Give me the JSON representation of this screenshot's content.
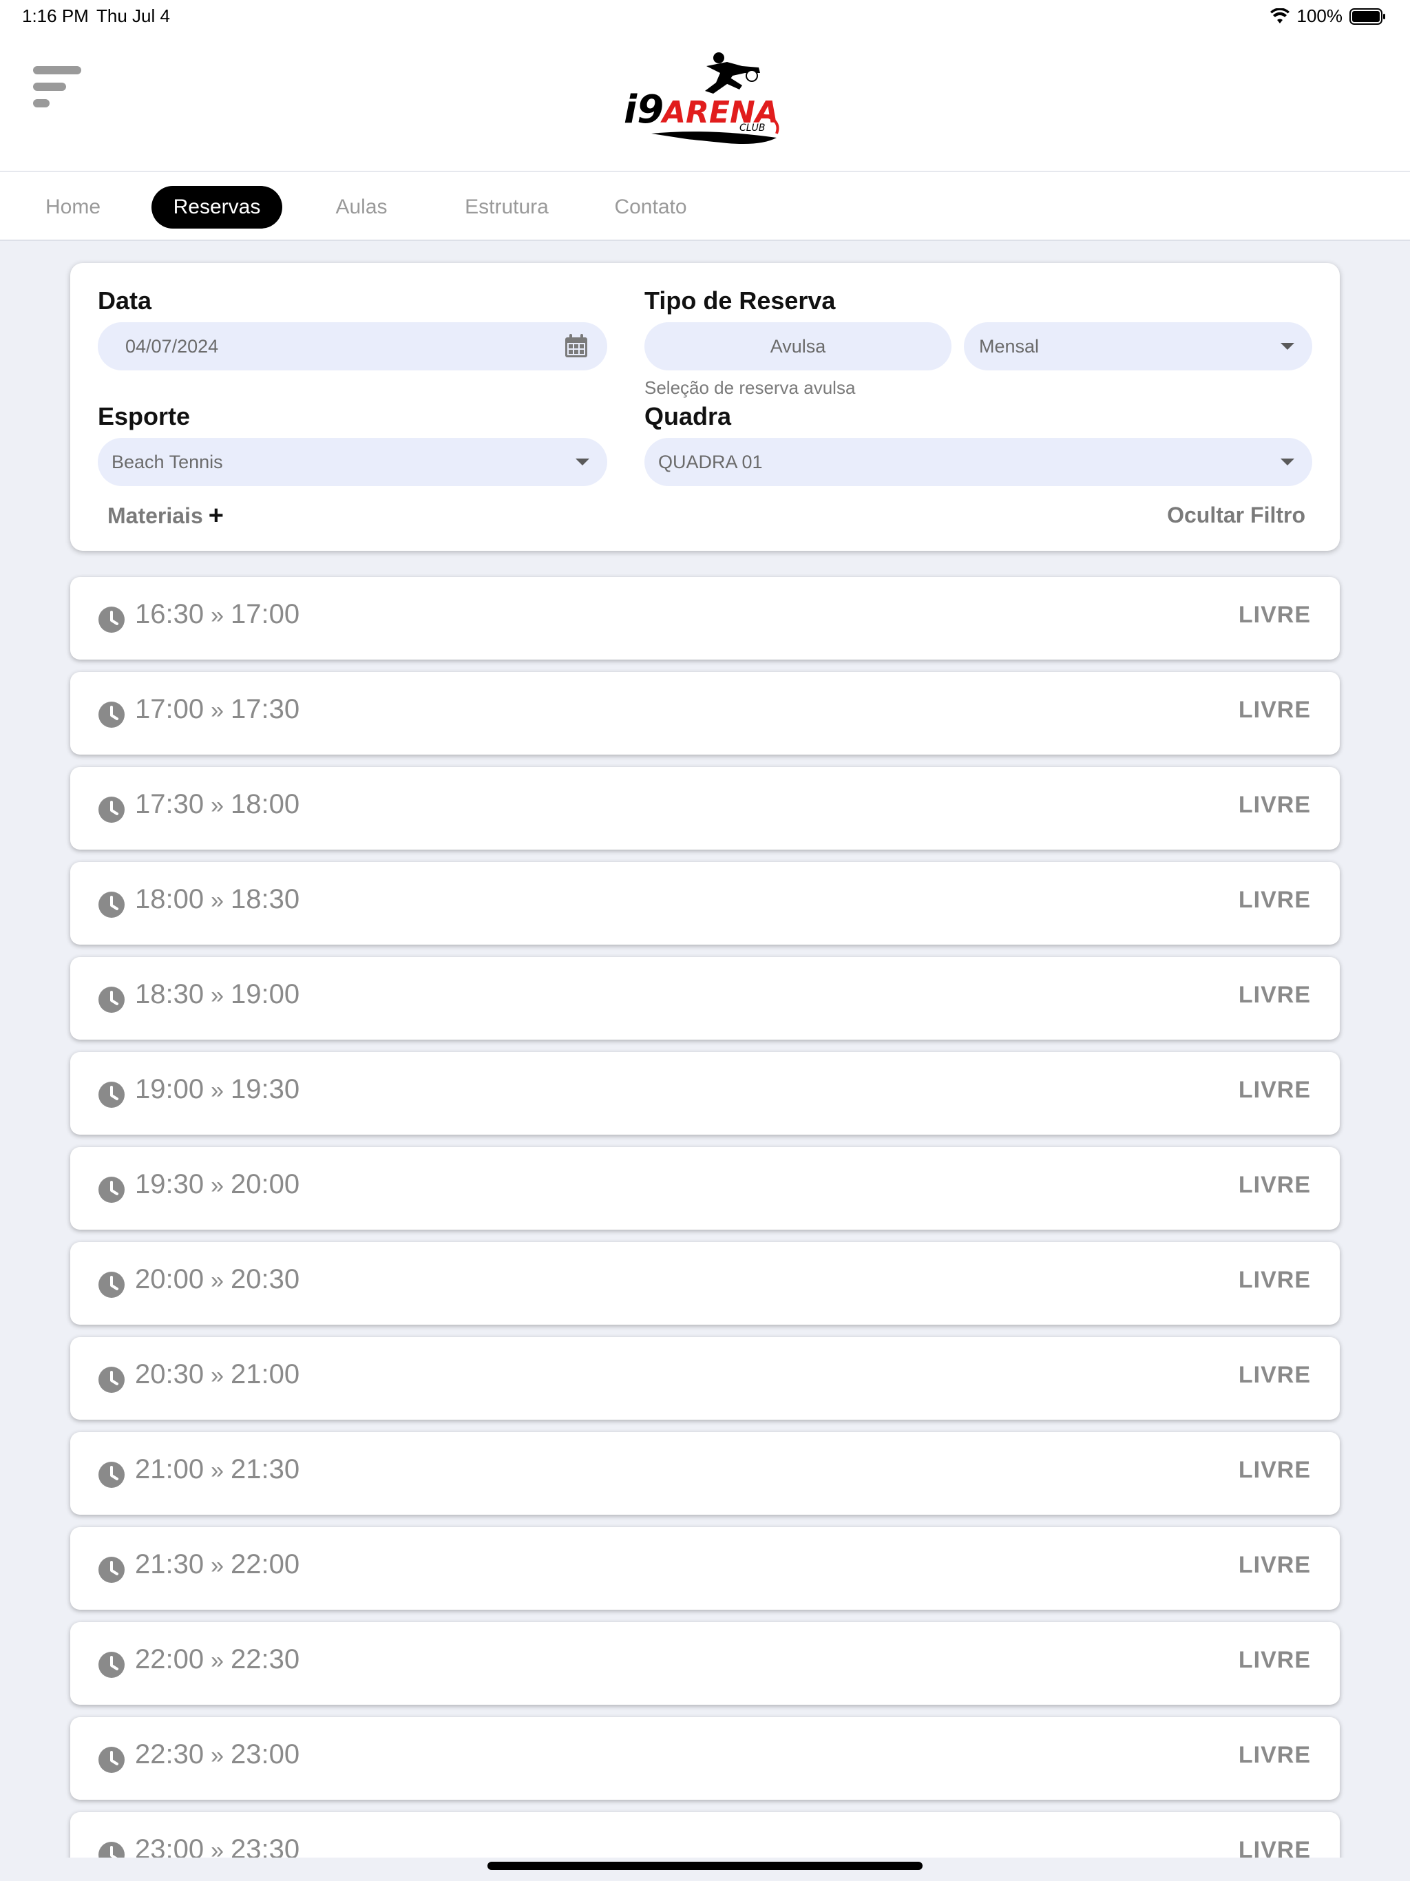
{
  "status_bar": {
    "time": "1:16 PM",
    "date": "Thu Jul 4",
    "battery": "100%"
  },
  "brand": {
    "logo_text_i9": "i9",
    "logo_text_arena": "ARENA",
    "logo_text_club": "CLUB",
    "accent_color": "#e11d1d"
  },
  "tabs": [
    {
      "label": "Home"
    },
    {
      "label": "Reservas"
    },
    {
      "label": "Aulas"
    },
    {
      "label": "Estrutura"
    },
    {
      "label": "Contato"
    }
  ],
  "active_tab": "Reservas",
  "filter": {
    "data_label": "Data",
    "data_value": "04/07/2024",
    "tipo_label": "Tipo de Reserva",
    "tipo_option_avulsa": "Avulsa",
    "tipo_option_mensal": "Mensal",
    "tipo_hint": "Seleção de reserva avulsa",
    "esporte_label": "Esporte",
    "esporte_value": "Beach Tennis",
    "quadra_label": "Quadra",
    "quadra_value": "QUADRA 01",
    "materiais_label": "Materiais",
    "ocultar_label": "Ocultar Filtro"
  },
  "slots": [
    {
      "start": "16:30",
      "end": "17:00",
      "status": "LIVRE"
    },
    {
      "start": "17:00",
      "end": "17:30",
      "status": "LIVRE"
    },
    {
      "start": "17:30",
      "end": "18:00",
      "status": "LIVRE"
    },
    {
      "start": "18:00",
      "end": "18:30",
      "status": "LIVRE"
    },
    {
      "start": "18:30",
      "end": "19:00",
      "status": "LIVRE"
    },
    {
      "start": "19:00",
      "end": "19:30",
      "status": "LIVRE"
    },
    {
      "start": "19:30",
      "end": "20:00",
      "status": "LIVRE"
    },
    {
      "start": "20:00",
      "end": "20:30",
      "status": "LIVRE"
    },
    {
      "start": "20:30",
      "end": "21:00",
      "status": "LIVRE"
    },
    {
      "start": "21:00",
      "end": "21:30",
      "status": "LIVRE"
    },
    {
      "start": "21:30",
      "end": "22:00",
      "status": "LIVRE"
    },
    {
      "start": "22:00",
      "end": "22:30",
      "status": "LIVRE"
    },
    {
      "start": "22:30",
      "end": "23:00",
      "status": "LIVRE"
    },
    {
      "start": "23:00",
      "end": "23:30",
      "status": "LIVRE"
    }
  ],
  "slot_separator": "»"
}
